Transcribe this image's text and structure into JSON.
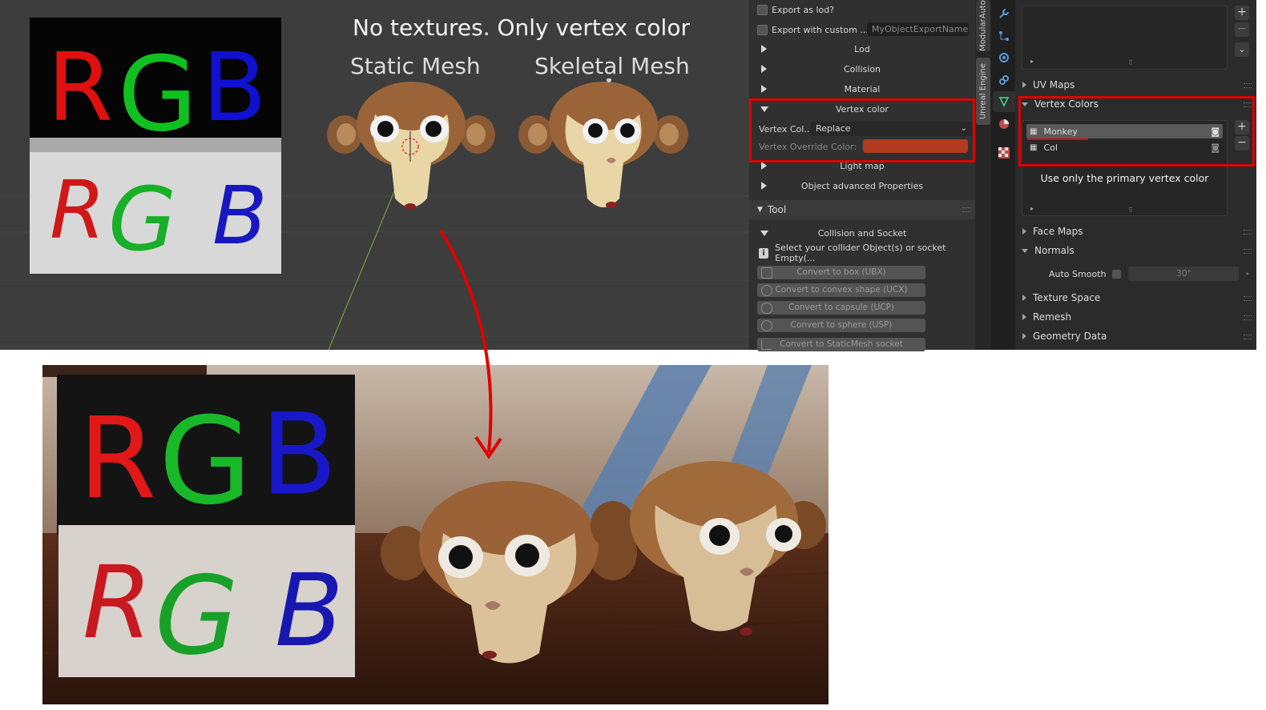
{
  "viewport": {
    "title": "No textures. Only vertex color",
    "static_label": "Static Mesh",
    "skeletal_label": "Skeletal Mesh",
    "sign_top_letters": [
      "R",
      "G",
      "B"
    ],
    "sign_bottom_letters": [
      "R",
      "G",
      "B"
    ],
    "colors": {
      "red": "#e01010",
      "green": "#10c020",
      "blue": "#1010d0"
    }
  },
  "export_panel": {
    "export_as_lod": "Export as lod?",
    "export_custom_name": "Export with custom ...",
    "custom_name_placeholder": "MyObjectExportName...",
    "sections": {
      "lod": "Lod",
      "collision": "Collision",
      "material": "Material",
      "vertex_color": "Vertex color",
      "light_map": "Light map",
      "advanced": "Object advanced Properties"
    },
    "vertex_col_label": "Vertex Col...",
    "vertex_col_value": "Replace",
    "override_label": "Vertex Override Color:",
    "override_color": "#b23a1f",
    "tool_header": "Tool",
    "collision_socket": "Collision and Socket",
    "info_text": "Select your collider Object(s) or socket Empty(...",
    "tool_buttons": [
      "Convert to box (UBX)",
      "Convert to convex shape (UCX)",
      "Convert to capsule (UCP)",
      "Convert to sphere (USP)",
      "Convert to StaticMesh socket"
    ]
  },
  "vertical_tabs": [
    "ModularAuto",
    "Unreal Engine"
  ],
  "sidebar_icons": [
    "wrench-icon",
    "particles-icon",
    "physics-icon",
    "constraints-icon",
    "mesh-data-icon",
    "material-icon",
    "texture-icon"
  ],
  "props": {
    "uv_maps": "UV Maps",
    "vertex_colors": "Vertex Colors",
    "layers": [
      "Monkey",
      "Col"
    ],
    "annotation": "Use only the primary vertex color",
    "face_maps": "Face Maps",
    "normals": "Normals",
    "auto_smooth": "Auto Smooth",
    "angle": "30°",
    "texture_space": "Texture Space",
    "remesh": "Remesh",
    "geometry_data": "Geometry Data",
    "add": "+",
    "remove": "−"
  },
  "highlight_color": "#e00000"
}
